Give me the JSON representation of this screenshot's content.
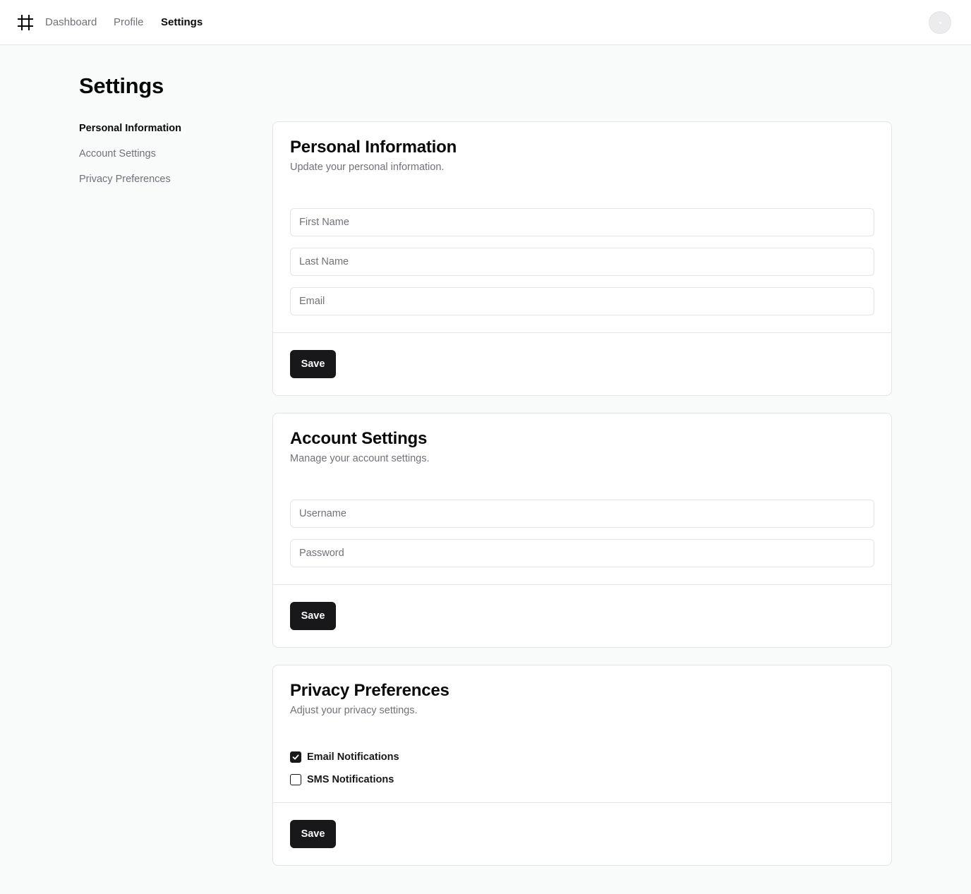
{
  "header": {
    "logo_icon": "hash-icon",
    "nav": [
      {
        "label": "Dashboard",
        "active": false
      },
      {
        "label": "Profile",
        "active": false
      },
      {
        "label": "Settings",
        "active": true
      }
    ],
    "avatar_icon": "user-avatar"
  },
  "page": {
    "title": "Settings"
  },
  "sidebar": {
    "items": [
      {
        "label": "Personal Information",
        "active": true
      },
      {
        "label": "Account Settings",
        "active": false
      },
      {
        "label": "Privacy Preferences",
        "active": false
      }
    ]
  },
  "personal": {
    "title": "Personal Information",
    "description": "Update your personal information.",
    "first_name_placeholder": "First Name",
    "last_name_placeholder": "Last Name",
    "email_placeholder": "Email",
    "save_label": "Save"
  },
  "account": {
    "title": "Account Settings",
    "description": "Manage your account settings.",
    "username_placeholder": "Username",
    "password_placeholder": "Password",
    "save_label": "Save"
  },
  "privacy": {
    "title": "Privacy Preferences",
    "description": "Adjust your privacy settings.",
    "options": [
      {
        "label": "Email Notifications",
        "checked": true
      },
      {
        "label": "SMS Notifications",
        "checked": false
      }
    ],
    "save_label": "Save"
  },
  "colors": {
    "background": "#f9fafa",
    "card": "#ffffff",
    "border": "#e4e4e7",
    "primary": "#18181b",
    "muted_text": "#71717a"
  }
}
